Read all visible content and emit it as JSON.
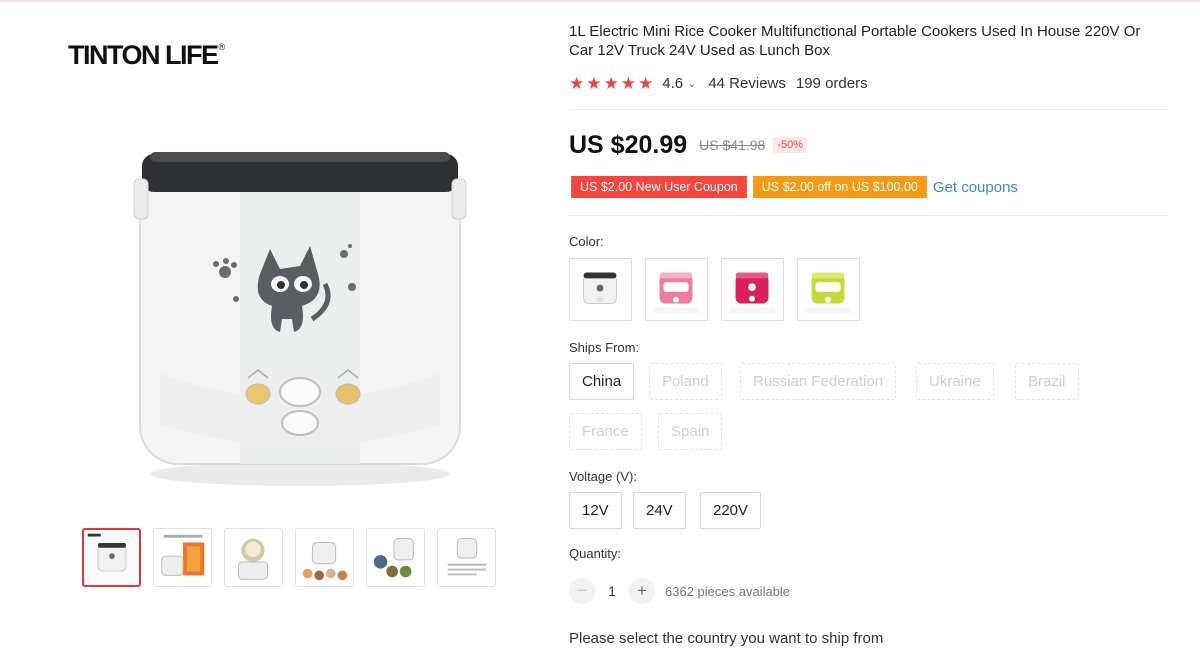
{
  "brand": {
    "logo_text": "TINTON LIFE",
    "registered_mark": "®"
  },
  "product": {
    "title": "1L Electric Mini Rice Cooker Multifunctional Portable Cookers Used In House 220V Or Car 12V Truck 24V Used as Lunch Box",
    "rating": "4.6",
    "rating_chevron": "⌄",
    "reviews": "44 Reviews",
    "orders": "199 orders",
    "stars": 5
  },
  "pricing": {
    "price": "US $20.99",
    "old_price": "US $41.98",
    "discount": "-50%"
  },
  "coupons": {
    "new_user": "US $2.00 New User Coupon",
    "off": "US $2.00 off on US $100.00",
    "get_label": "Get coupons"
  },
  "color": {
    "label": "Color:",
    "options": [
      "white",
      "pink",
      "rose-red",
      "lime-green"
    ],
    "swatch_colors": {
      "white": "#f1f1f1",
      "pink": "#f07b9a",
      "rose-red": "#d9225a",
      "lime-green": "#c7d93a"
    }
  },
  "ships_from": {
    "label": "Ships From:",
    "options": [
      "China",
      "Poland",
      "Russian Federation",
      "Ukraine",
      "Brazil",
      "France",
      "Spain"
    ],
    "selected": "China"
  },
  "voltage": {
    "label": "Voltage (V):",
    "options": [
      "12V",
      "24V",
      "220V"
    ]
  },
  "quantity": {
    "label": "Quantity:",
    "minus": "−",
    "plus": "+",
    "value": "1",
    "available": "6362 pieces available"
  },
  "ship_note": "Please select the country you want to ship from",
  "colors": {
    "accent_red": "#f5453f",
    "coupon_orange": "#f59a16",
    "star_red": "#e84646",
    "link_blue": "#3b8dbd",
    "active_thumb": "#d73a3a"
  }
}
